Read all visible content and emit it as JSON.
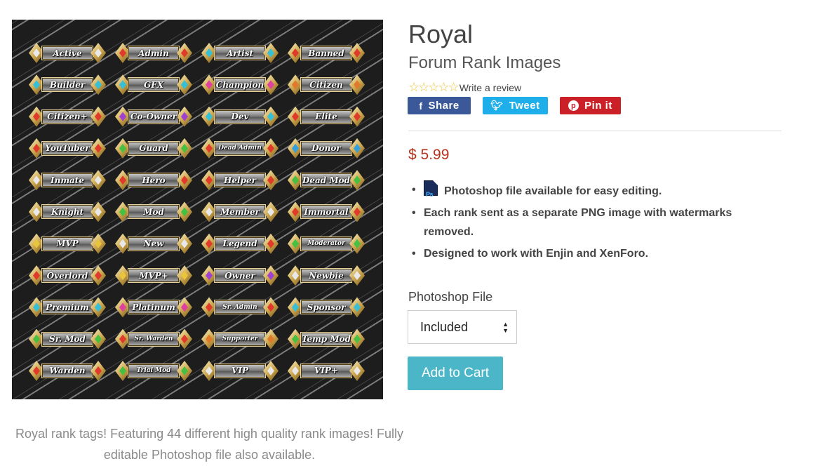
{
  "product": {
    "title": "Royal",
    "subtitle": "Forum Rank Images",
    "stars": "☆☆☆☆☆",
    "write_review": "Write a review",
    "price": "$ 5.99",
    "description": "Royal rank tags! Featuring 44 different high quality rank images! Fully editable Photoshop file also available."
  },
  "social": {
    "share": "Share",
    "tweet": "Tweet",
    "pin": "Pin it",
    "share_color": "#3b5998",
    "tweet_color": "#1eaeea",
    "pin_color": "#cb2027"
  },
  "features": [
    "Photoshop file available for easy editing.",
    "Each rank sent as a separate PNG image with watermarks removed.",
    "Designed to work with Enjin and XenForo."
  ],
  "ps_icon_text": "Ps",
  "option": {
    "label": "Photoshop File",
    "selected": "Included"
  },
  "cart": {
    "label": "Add to Cart",
    "color": "#4ab6c8"
  },
  "rank_images": [
    {
      "label": "Active",
      "gem": "#e8e8e8"
    },
    {
      "label": "Admin",
      "gem": "#e03a2a"
    },
    {
      "label": "Artist",
      "gem": "#35c0d8"
    },
    {
      "label": "Banned",
      "gem": "#e03a2a"
    },
    {
      "label": "Builder",
      "gem": "#35c0d8"
    },
    {
      "label": "GFX",
      "gem": "#35c0d8"
    },
    {
      "label": "Champion",
      "gem": "#e040a0"
    },
    {
      "label": "Citizen",
      "gem": "#e07a2a"
    },
    {
      "label": "Citizen+",
      "gem": "#e03a2a"
    },
    {
      "label": "Co-Owner",
      "gem": "#a040d0"
    },
    {
      "label": "Dev",
      "gem": "#35c0d8"
    },
    {
      "label": "Elite",
      "gem": "#e03a2a"
    },
    {
      "label": "YouTuber",
      "gem": "#e03a2a"
    },
    {
      "label": "Guard",
      "gem": "#45c040"
    },
    {
      "label": "Dead Admin",
      "gem": "#e03a2a"
    },
    {
      "label": "Donor",
      "gem": "#35a0e0"
    },
    {
      "label": "Inmate",
      "gem": "#e8e8e8"
    },
    {
      "label": "Hero",
      "gem": "#e03a2a"
    },
    {
      "label": "Helper",
      "gem": "#e03a2a"
    },
    {
      "label": "Dead Mod",
      "gem": "#45c040"
    },
    {
      "label": "Knight",
      "gem": "#e8e8e8"
    },
    {
      "label": "Mod",
      "gem": "#45c040"
    },
    {
      "label": "Member",
      "gem": "#e8e8e8"
    },
    {
      "label": "Immortal",
      "gem": "#e03a2a"
    },
    {
      "label": "MVP",
      "gem": "#e8c53a"
    },
    {
      "label": "New",
      "gem": "#e8e8e8"
    },
    {
      "label": "Legend",
      "gem": "#e03a2a"
    },
    {
      "label": "Moderator",
      "gem": "#45c040"
    },
    {
      "label": "Overlord",
      "gem": "#e03a2a"
    },
    {
      "label": "MVP+",
      "gem": "#e8c53a"
    },
    {
      "label": "Owner",
      "gem": "#a040d0"
    },
    {
      "label": "Newbie",
      "gem": "#e8e8e8"
    },
    {
      "label": "Premium",
      "gem": "#35c0d8"
    },
    {
      "label": "Platinum",
      "gem": "#e040a0"
    },
    {
      "label": "Sr. Admin",
      "gem": "#e03a2a"
    },
    {
      "label": "Sponsor",
      "gem": "#35c0d8"
    },
    {
      "label": "Sr. Mod",
      "gem": "#45c040"
    },
    {
      "label": "Sr. Warden",
      "gem": "#e03a2a"
    },
    {
      "label": "Supporter",
      "gem": "#e07a2a"
    },
    {
      "label": "Temp Mod",
      "gem": "#45c040"
    },
    {
      "label": "Warden",
      "gem": "#e03a2a"
    },
    {
      "label": "Trial Mod",
      "gem": "#45c040"
    },
    {
      "label": "VIP",
      "gem": "#e8e8e8"
    },
    {
      "label": "VIP+",
      "gem": "#e8e8e8"
    }
  ]
}
